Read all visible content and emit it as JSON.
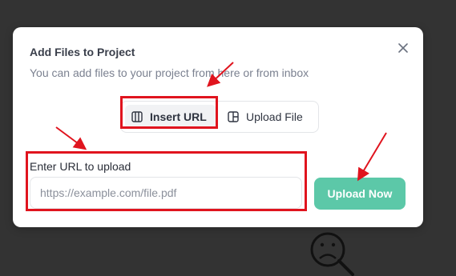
{
  "modal": {
    "title": "Add Files to Project",
    "subtitle": "You can add files to your project from here or from inbox",
    "close_icon": "close-icon"
  },
  "tabs": [
    {
      "label": "Insert URL",
      "icon": "columns-icon",
      "active": true
    },
    {
      "label": "Upload File",
      "icon": "layout-icon",
      "active": false
    }
  ],
  "url_field": {
    "label": "Enter URL to upload",
    "value": "",
    "placeholder": "https://example.com/file.pdf"
  },
  "upload_button": {
    "label": "Upload Now"
  },
  "colors": {
    "background": "#333333",
    "accent": "#5cc8a8",
    "annotation": "#e0141e"
  },
  "background_icon": "sad-face-icon"
}
